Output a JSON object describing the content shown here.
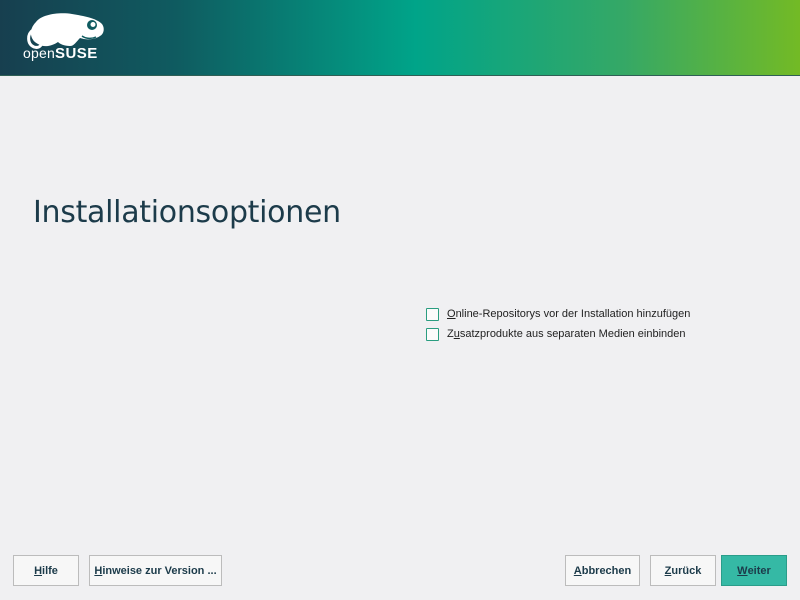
{
  "brand": {
    "logo_text_prefix": "open",
    "logo_text_suffix": "SUSE",
    "logo_icon": "opensuse-chameleon-icon",
    "gradient_colors": [
      "#173f4f",
      "#00a489",
      "#73ba25"
    ]
  },
  "main": {
    "title": "Installationsoptionen"
  },
  "options": [
    {
      "mnemonic": "O",
      "rest": "nline-Repositorys vor der Installation hinzufügen",
      "checked": false
    },
    {
      "prefix": "Z",
      "mnemonic": "u",
      "rest": "satzprodukte aus separaten Medien einbinden",
      "checked": false
    }
  ],
  "buttons": {
    "help": {
      "mnemonic": "H",
      "rest": "ilfe"
    },
    "release_notes": {
      "mnemonic": "H",
      "rest": "inweise zur Version ..."
    },
    "abort": {
      "mnemonic": "A",
      "rest": "bbrechen"
    },
    "back": {
      "mnemonic": "Z",
      "rest": "urück"
    },
    "next": {
      "mnemonic": "W",
      "rest": "eiter"
    }
  },
  "colors": {
    "accent": "#35b9a5",
    "title": "#1c3b4a",
    "background": "#f0f0f2"
  }
}
